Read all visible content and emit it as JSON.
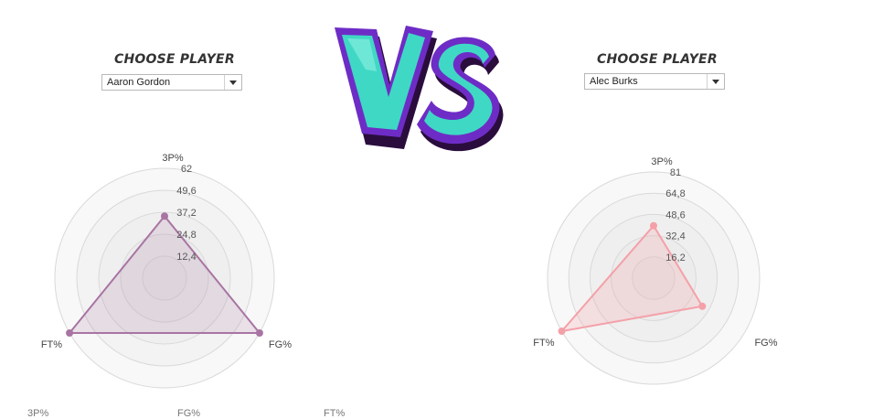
{
  "left_player": {
    "choose_label": "CHOOSE PLAYER",
    "selected": "Aaron Gordon",
    "color": "#a874a3",
    "fill": "rgba(168,116,163,0.18)",
    "chart_data": {
      "type": "radar",
      "axes": [
        "3P%",
        "FG%",
        "FT%"
      ],
      "ticks": [
        "62",
        "49,6",
        "37,2",
        "24,8",
        "12,4"
      ],
      "max": 62,
      "values": [
        35,
        62,
        62
      ]
    }
  },
  "right_player": {
    "choose_label": "CHOOSE PLAYER",
    "selected": "Alec Burks",
    "color": "#f4a0a8",
    "fill": "rgba(244,160,168,0.25)",
    "chart_data": {
      "type": "radar",
      "axes": [
        "3P%",
        "FG%",
        "FT%"
      ],
      "ticks": [
        "81",
        "64,8",
        "48,6",
        "32,4",
        "16,2"
      ],
      "max": 81,
      "values": [
        40,
        43,
        81
      ]
    }
  },
  "vs_logo": {
    "text": "VS"
  },
  "cutoff_labels": [
    "3P%",
    "FG%",
    "FT%"
  ]
}
